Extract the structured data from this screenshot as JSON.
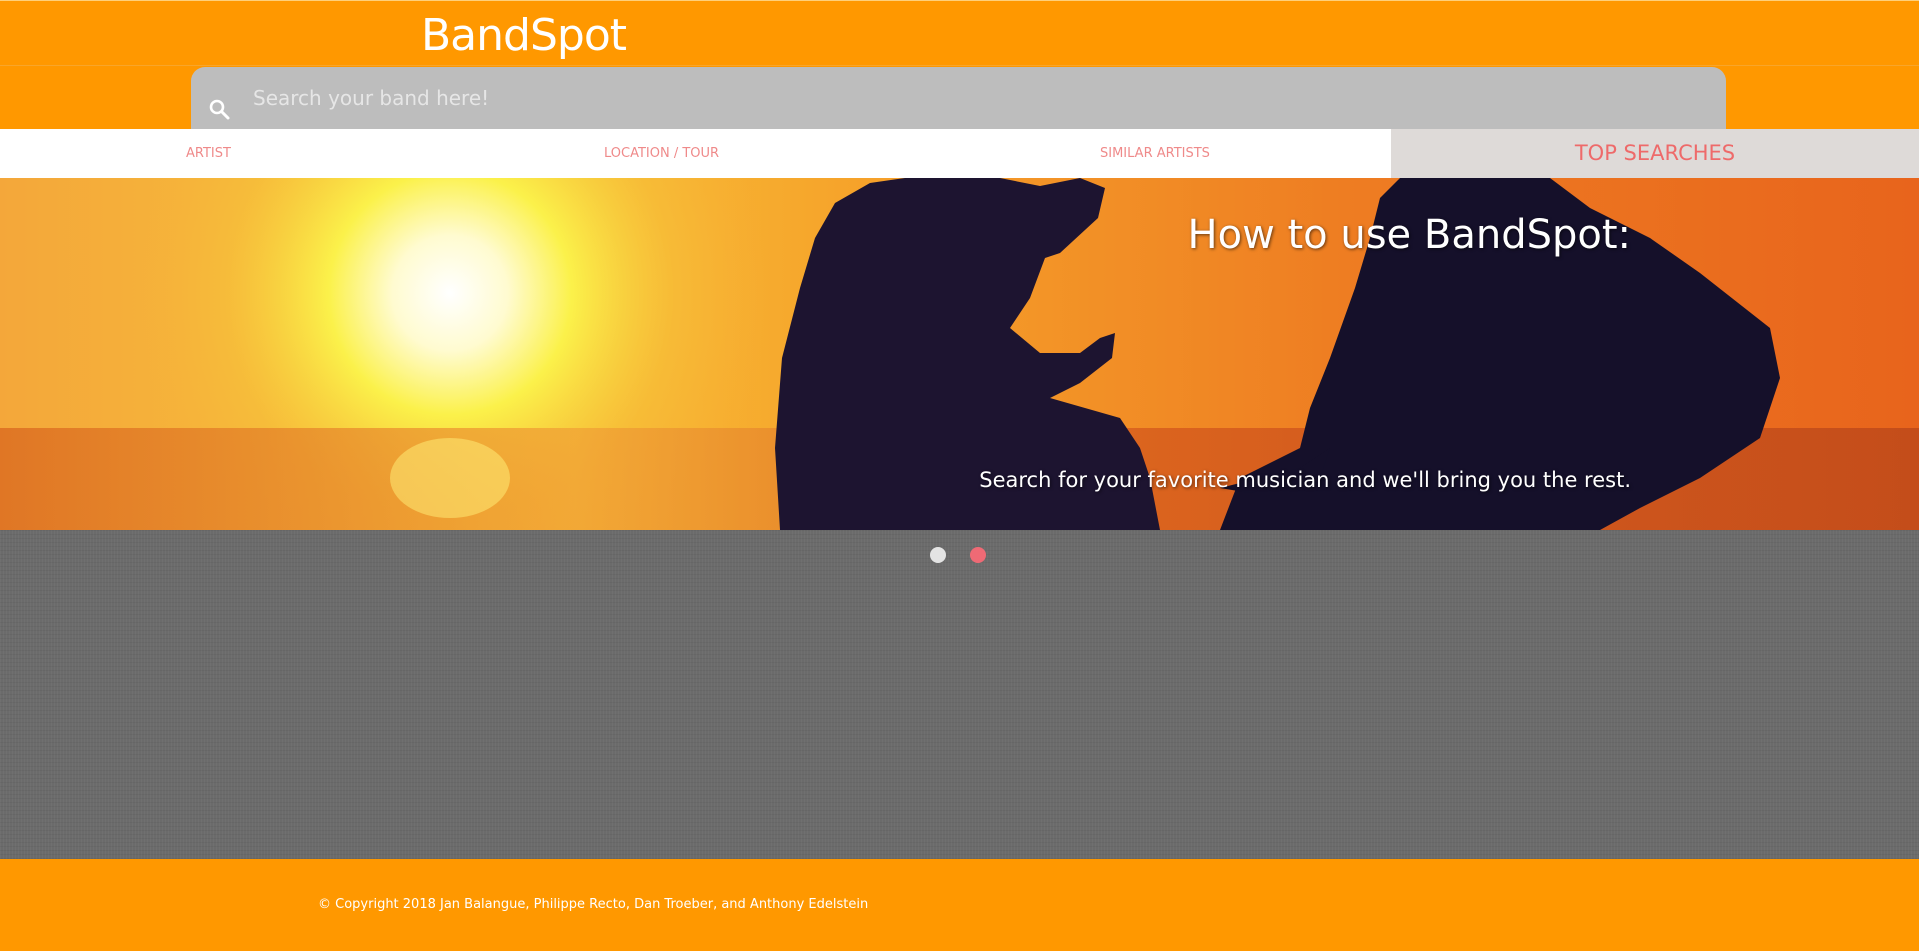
{
  "header": {
    "logo": "BandSpot",
    "search": {
      "placeholder": "Search your band here!",
      "value": ""
    }
  },
  "nav": {
    "items": [
      {
        "label": "ARTIST"
      },
      {
        "label": "LOCATION / TOUR"
      },
      {
        "label": "SIMILAR ARTISTS"
      },
      {
        "label": "TOP SEARCHES"
      }
    ],
    "active_item": "TOP SEARCHES"
  },
  "hero": {
    "title": "How to use BandSpot:",
    "subtitle": "Search for your favorite musician and we'll bring you the rest."
  },
  "carousel": {
    "slide_count": 2,
    "active_slide": 2
  },
  "footer": {
    "copyright": "© Copyright 2018 Jan Balangue, Philippe Recto, Dan Troeber, and Anthony Edelstein"
  },
  "colors": {
    "brand_orange": "#ff9800",
    "accent_pink": "#ef6a75",
    "nav_text": "#ef8a8a",
    "search_bg": "#bdbdbd"
  },
  "icons": {
    "search": "magnifier-icon"
  }
}
